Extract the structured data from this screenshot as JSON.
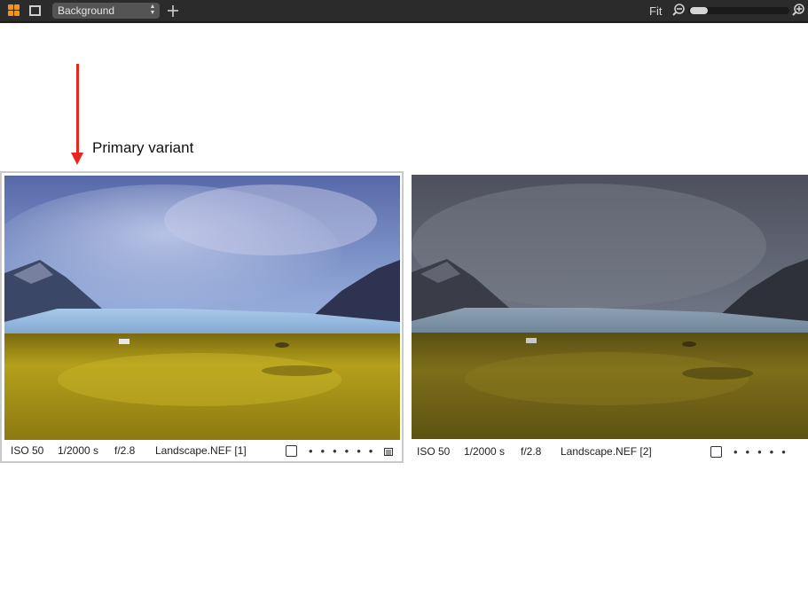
{
  "toolbar": {
    "select_label": "Background",
    "fit_label": "Fit",
    "zoom_level": 0.05
  },
  "annotation": {
    "label": "Primary variant"
  },
  "variants": [
    {
      "iso": "ISO 50",
      "shutter": "1/2000 s",
      "aperture": "f/2.8",
      "filename": "Landscape.NEF [1]",
      "selected": true
    },
    {
      "iso": "ISO 50",
      "shutter": "1/2000 s",
      "aperture": "f/2.8",
      "filename": "Landscape.NEF [2]",
      "selected": false
    }
  ],
  "colors": {
    "accent": "#f0961e",
    "annotation": "#e8251f",
    "selection_border": "#c9c9c9"
  },
  "icons": [
    "grid-view-icon",
    "single-view-icon",
    "add-icon",
    "zoom-out-icon",
    "zoom-in-icon",
    "rating-dots",
    "adjustment-badge-icon"
  ]
}
